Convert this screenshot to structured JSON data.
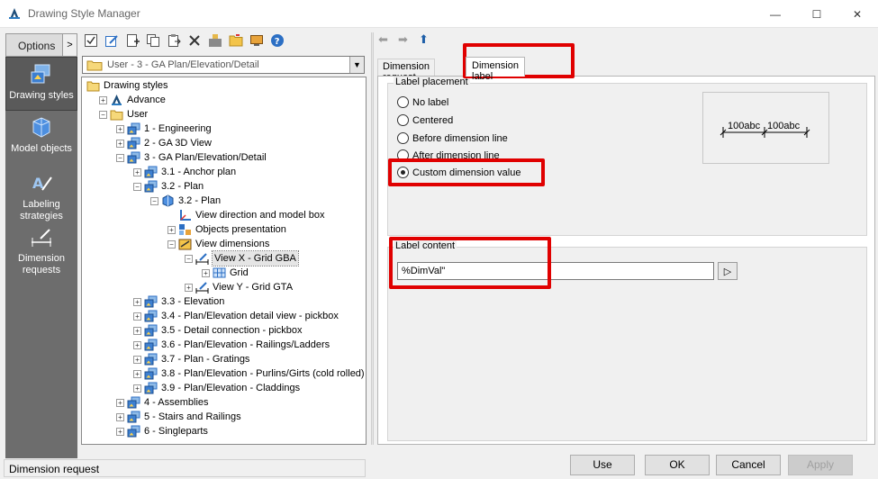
{
  "window": {
    "title": "Drawing Style Manager",
    "minimize_glyph": "—",
    "maximize_glyph": "☐",
    "close_glyph": "✕"
  },
  "sidebar": {
    "options_label": "Options",
    "options_arrow": ">",
    "items": [
      {
        "label_lines": [
          "Drawing styles"
        ],
        "icon": "drawing-styles-icon",
        "active": true
      },
      {
        "label_lines": [
          "Model objects"
        ],
        "icon": "model-objects-icon",
        "active": false
      },
      {
        "label_lines": [
          "Labeling",
          "strategies"
        ],
        "icon": "labeling-strategies-icon",
        "active": false
      },
      {
        "label_lines": [
          "Dimension",
          "requests"
        ],
        "icon": "dimension-requests-icon",
        "active": false
      }
    ]
  },
  "toolbar": {
    "icons": [
      "check-icon",
      "edit-icon",
      "add-icon",
      "copy-icon",
      "paste-icon",
      "delete-icon",
      "import-icon",
      "folder-icon",
      "monitor-icon",
      "help-icon"
    ]
  },
  "style_selector": {
    "value": "User - 3 - GA Plan/Elevation/Detail",
    "arrow": "▼"
  },
  "tree": {
    "nodes": [
      {
        "label": "Drawing styles",
        "level": 0,
        "icon": "folder",
        "expander": ""
      },
      {
        "label": "Advance",
        "level": 1,
        "icon": "advance",
        "expander": "+"
      },
      {
        "label": "User",
        "level": 1,
        "icon": "folder",
        "expander": "−"
      },
      {
        "label": "1 - Engineering",
        "level": 2,
        "icon": "style",
        "expander": "+"
      },
      {
        "label": "2 - GA 3D View",
        "level": 2,
        "icon": "style",
        "expander": "+"
      },
      {
        "label": "3 - GA Plan/Elevation/Detail",
        "level": 2,
        "icon": "style",
        "expander": "−"
      },
      {
        "label": "3.1 - Anchor plan",
        "level": 3,
        "icon": "style",
        "expander": "+"
      },
      {
        "label": "3.2 - Plan",
        "level": 3,
        "icon": "style",
        "expander": "−"
      },
      {
        "label": "3.2 - Plan",
        "level": 4,
        "icon": "cube",
        "expander": "−"
      },
      {
        "label": "View direction and model box",
        "level": 5,
        "icon": "axes",
        "expander": ""
      },
      {
        "label": "Objects presentation",
        "level": 5,
        "icon": "objects",
        "expander": "+"
      },
      {
        "label": "View dimensions",
        "level": 5,
        "icon": "viewdims",
        "expander": "−"
      },
      {
        "label": "View X - Grid GBA",
        "level": 6,
        "icon": "dimension",
        "expander": "−",
        "selected": true
      },
      {
        "label": "Grid",
        "level": 7,
        "icon": "grid",
        "expander": "+"
      },
      {
        "label": "View Y - Grid GTA",
        "level": 6,
        "icon": "dimension",
        "expander": "+"
      },
      {
        "label": "3.3 - Elevation",
        "level": 3,
        "icon": "style",
        "expander": "+"
      },
      {
        "label": "3.4 - Plan/Elevation detail view - pickbox",
        "level": 3,
        "icon": "style",
        "expander": "+"
      },
      {
        "label": "3.5 - Detail connection - pickbox",
        "level": 3,
        "icon": "style",
        "expander": "+"
      },
      {
        "label": "3.6 - Plan/Elevation - Railings/Ladders",
        "level": 3,
        "icon": "style",
        "expander": "+"
      },
      {
        "label": "3.7 - Plan - Gratings",
        "level": 3,
        "icon": "style",
        "expander": "+"
      },
      {
        "label": "3.8 - Plan/Elevation - Purlins/Girts (cold rolled)",
        "level": 3,
        "icon": "style",
        "expander": "+"
      },
      {
        "label": "3.9 - Plan/Elevation - Claddings",
        "level": 3,
        "icon": "style",
        "expander": "+"
      },
      {
        "label": "4 - Assemblies",
        "level": 2,
        "icon": "style",
        "expander": "+"
      },
      {
        "label": "5 - Stairs and Railings",
        "level": 2,
        "icon": "style",
        "expander": "+"
      },
      {
        "label": "6 - Singleparts",
        "level": 2,
        "icon": "style",
        "expander": "+"
      }
    ]
  },
  "nav": {
    "back": "⬅",
    "forward": "➡",
    "up": "⬆"
  },
  "tabs": [
    {
      "label": "Dimension request",
      "active": false
    },
    {
      "label": "Dimension label",
      "active": true
    }
  ],
  "label_placement": {
    "legend": "Label placement",
    "options": [
      {
        "label": "No label",
        "checked": false
      },
      {
        "label": "Centered",
        "checked": false
      },
      {
        "label": "Before dimension line",
        "checked": false
      },
      {
        "label": "After dimension line",
        "checked": false
      },
      {
        "label": "Custom dimension value",
        "checked": true
      }
    ],
    "preview": {
      "label_left": "100abc",
      "label_right": "100abc"
    }
  },
  "label_content": {
    "legend": "Label content",
    "value": "%DimVal\"",
    "button_glyph": "▷"
  },
  "status": {
    "text": "Dimension request"
  },
  "buttons": {
    "use": "Use",
    "ok": "OK",
    "cancel": "Cancel",
    "apply": "Apply"
  },
  "colors": {
    "highlight": "#e00000",
    "sidebar_bg": "#6d6d6d"
  }
}
